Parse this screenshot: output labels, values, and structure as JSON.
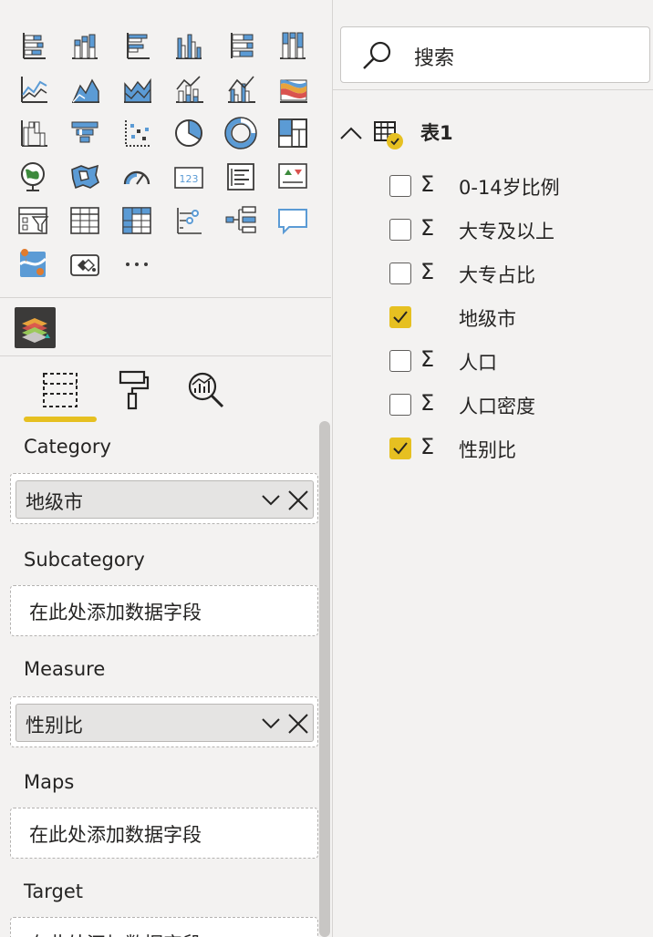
{
  "visualizations": {
    "icons": [
      "stacked-bar-chart-icon",
      "stacked-column-chart-icon",
      "clustered-bar-chart-icon",
      "clustered-column-chart-icon",
      "100-stacked-bar-chart-icon",
      "100-stacked-column-chart-icon",
      "line-chart-icon",
      "area-chart-icon",
      "stacked-area-chart-icon",
      "line-and-stacked-column-chart-icon",
      "line-and-clustered-column-chart-icon",
      "ribbon-chart-icon",
      "waterfall-chart-icon",
      "funnel-icon",
      "scatter-chart-icon",
      "pie-chart-icon",
      "donut-chart-icon",
      "treemap-icon",
      "map-icon",
      "filled-map-icon",
      "gauge-icon",
      "card-icon",
      "multi-row-card-icon",
      "kpi-icon",
      "slicer-icon",
      "table-icon",
      "matrix-icon",
      "key-influencers-icon",
      "decomposition-tree-icon",
      "qa-icon",
      "arcgis-map-icon",
      "power-apps-icon",
      "more-visuals-icon"
    ],
    "custom_visual": "custom-map-visual-icon",
    "tabs": [
      "fields-tab-icon",
      "format-tab-icon",
      "analytics-tab-icon"
    ],
    "wells": [
      {
        "label": "Category",
        "field": "地级市",
        "placeholder": ""
      },
      {
        "label": "Subcategory",
        "field": "",
        "placeholder": "在此处添加数据字段"
      },
      {
        "label": "Measure",
        "field": "性别比",
        "placeholder": ""
      },
      {
        "label": "Maps",
        "field": "",
        "placeholder": "在此处添加数据字段"
      },
      {
        "label": "Target",
        "field": "",
        "placeholder": "在此处添加数据字段"
      }
    ]
  },
  "fields_pane": {
    "search_placeholder": "搜索",
    "table_name": "表1",
    "fields": [
      {
        "name": "0-14岁比例",
        "checked": false,
        "sigma": true
      },
      {
        "name": "大专及以上",
        "checked": false,
        "sigma": true
      },
      {
        "name": "大专占比",
        "checked": false,
        "sigma": true
      },
      {
        "name": "地级市",
        "checked": true,
        "sigma": false
      },
      {
        "name": "人口",
        "checked": false,
        "sigma": true
      },
      {
        "name": "人口密度",
        "checked": false,
        "sigma": true
      },
      {
        "name": "性别比",
        "checked": true,
        "sigma": true
      }
    ]
  },
  "colors": {
    "accent": "#e6c021",
    "icon_blue": "#5b9bd5",
    "icon_dark": "#3b3a39"
  }
}
